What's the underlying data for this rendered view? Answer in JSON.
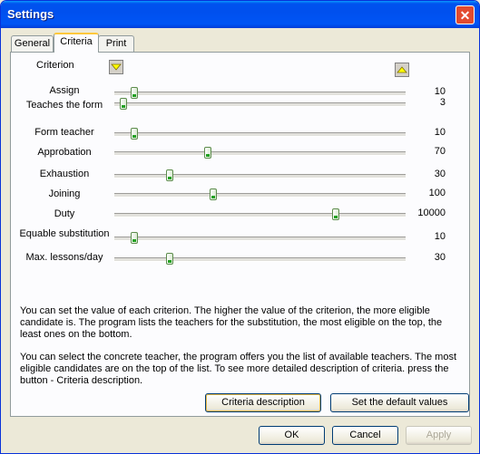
{
  "window": {
    "title": "Settings",
    "close_glyph": "✕"
  },
  "tabs": [
    {
      "label": "General"
    },
    {
      "label": "Criteria"
    },
    {
      "label": "Print"
    }
  ],
  "criteria": {
    "header": "Criterion",
    "sort_down_icon": "arrow-down-icon",
    "sort_up_icon": "arrow-up-icon",
    "slider_range": [
      0,
      10000
    ],
    "items": [
      {
        "label": "Assign",
        "value": "10",
        "level": 0.07
      },
      {
        "label": "Teaches the form",
        "value": "3",
        "level": 0.03
      },
      {
        "label": "Form teacher",
        "value": "10",
        "level": 0.07
      },
      {
        "label": "Approbation",
        "value": "70",
        "level": 0.32
      },
      {
        "label": "Exhaustion",
        "value": "30",
        "level": 0.19
      },
      {
        "label": "Joining",
        "value": "100",
        "level": 0.34
      },
      {
        "label": "Duty",
        "value": "10000",
        "level": 0.76
      },
      {
        "label": "Equable substitution",
        "value": "10",
        "level": 0.07
      },
      {
        "label": "Max. lessons/day",
        "value": "30",
        "level": 0.19
      }
    ]
  },
  "description": {
    "para1": "You can set the value of each criterion. The higher the value of the criterion, the more eligible candidate is. The program lists the teachers for the substitution, the most eligible on the top, the least ones on the bottom.",
    "para2": "You can select the concrete teacher, the program offers you the list of available teachers. The most eligible candidates are on the top of the list. To see more detailed description of criteria. press the button - Criteria description."
  },
  "buttons": {
    "criteria_description": "Criteria description",
    "set_default": "Set the default values",
    "ok": "OK",
    "cancel": "Cancel",
    "apply": "Apply"
  },
  "colors": {
    "title_bar": "#0053ee",
    "active_tab_accent": "#ffc83c",
    "arrow_fill": "#ffff00"
  }
}
